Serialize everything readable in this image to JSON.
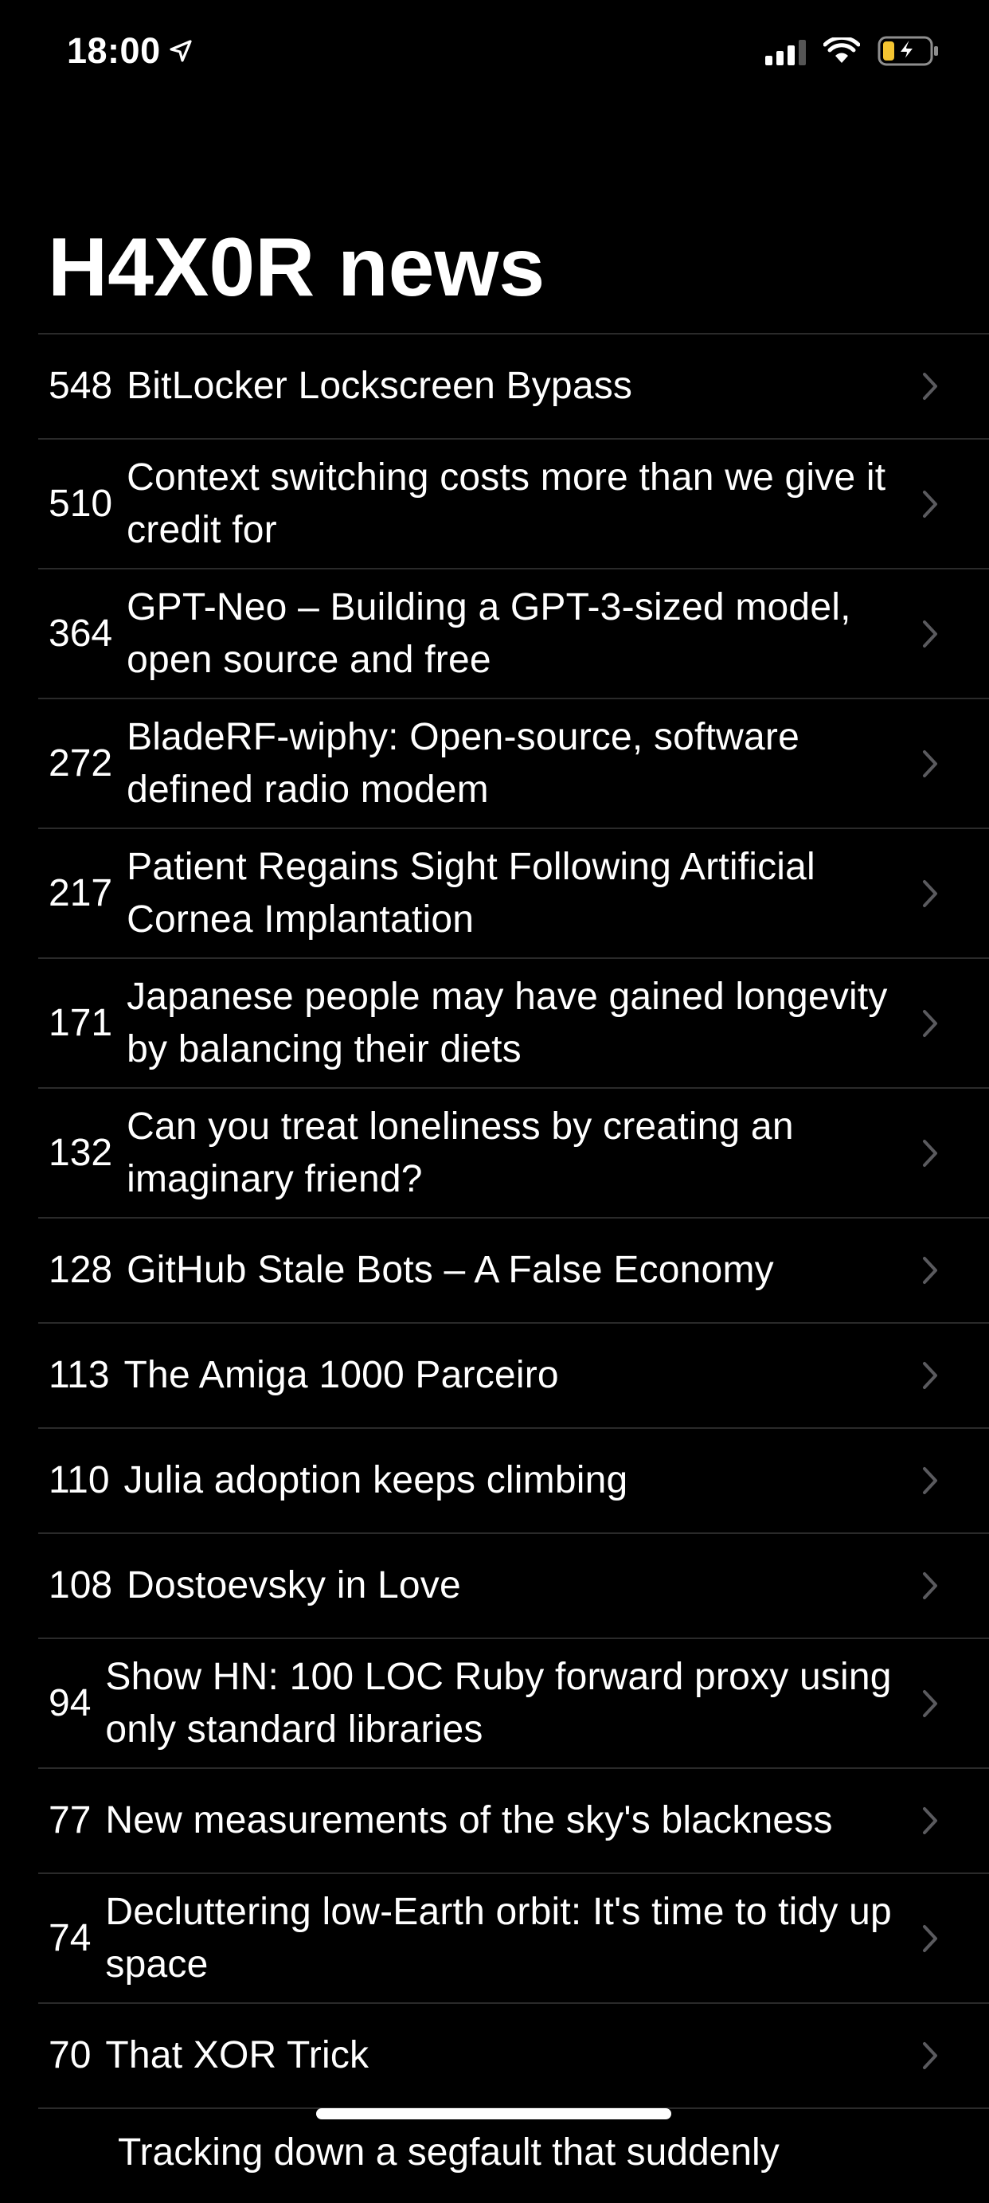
{
  "status_bar": {
    "time": "18:00"
  },
  "header": {
    "title": "H4X0R news"
  },
  "stories": [
    {
      "points": "548",
      "title": "BitLocker Lockscreen Bypass"
    },
    {
      "points": "510",
      "title": "Context switching costs more than we give it credit for"
    },
    {
      "points": "364",
      "title": "GPT-Neo – Building a GPT-3-sized model, open source and free"
    },
    {
      "points": "272",
      "title": "BladeRF-wiphy: Open-source, software defined radio modem"
    },
    {
      "points": "217",
      "title": "Patient Regains Sight Following Artificial Cornea Implantation"
    },
    {
      "points": "171",
      "title": "Japanese people may have gained longevity by balancing their diets"
    },
    {
      "points": "132",
      "title": "Can you treat loneliness by creating an imaginary friend?"
    },
    {
      "points": "128",
      "title": "GitHub Stale Bots – A False Economy"
    },
    {
      "points": "113",
      "title": "The Amiga 1000 Parceiro"
    },
    {
      "points": "110",
      "title": "Julia adoption keeps climbing"
    },
    {
      "points": "108",
      "title": "Dostoevsky in Love"
    },
    {
      "points": "94",
      "title": "Show HN: 100 LOC Ruby forward proxy using only standard libraries"
    },
    {
      "points": "77",
      "title": "New measurements of the sky's blackness"
    },
    {
      "points": "74",
      "title": "Decluttering low-Earth orbit: It's time to tidy up space"
    },
    {
      "points": "70",
      "title": "That XOR Trick"
    }
  ],
  "partial_story": {
    "title": "Tracking down a segfault that suddenly"
  }
}
